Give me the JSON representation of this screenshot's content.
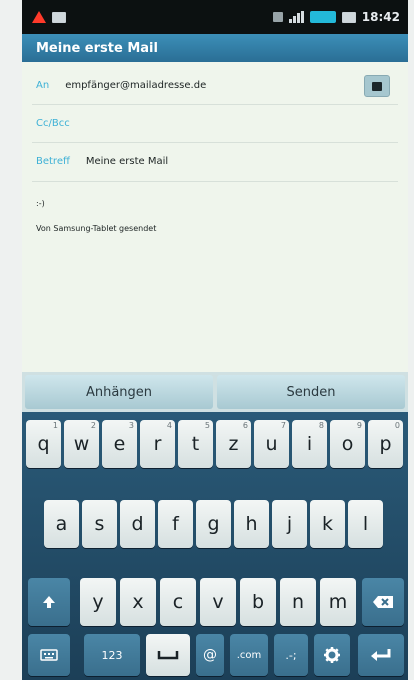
{
  "statusbar": {
    "time": "18:42"
  },
  "title": "Meine erste Mail",
  "compose": {
    "to_label": "An",
    "to_value": "empfänger@mailadresse.de",
    "cc_label": "Cc/Bcc",
    "subject_label": "Betreff",
    "subject_value": "Meine erste Mail",
    "body_line1": ":-)",
    "body_line2": "Von Samsung-Tablet gesendet"
  },
  "actions": {
    "attach": "Anhängen",
    "send": "Senden"
  },
  "keyboard": {
    "row1": [
      {
        "key": "q",
        "sub": "1"
      },
      {
        "key": "w",
        "sub": "2"
      },
      {
        "key": "e",
        "sub": "3"
      },
      {
        "key": "r",
        "sub": "4"
      },
      {
        "key": "t",
        "sub": "5"
      },
      {
        "key": "z",
        "sub": "6"
      },
      {
        "key": "u",
        "sub": "7"
      },
      {
        "key": "i",
        "sub": "8"
      },
      {
        "key": "o",
        "sub": "9"
      },
      {
        "key": "p",
        "sub": "0"
      }
    ],
    "row2": [
      "a",
      "s",
      "d",
      "f",
      "g",
      "h",
      "j",
      "k",
      "l"
    ],
    "row3": [
      "y",
      "x",
      "c",
      "v",
      "b",
      "n",
      "m"
    ],
    "numbers_label": "123",
    "at_label": "@",
    "dotcom_label": ".com",
    "punct_label": ".-;"
  }
}
